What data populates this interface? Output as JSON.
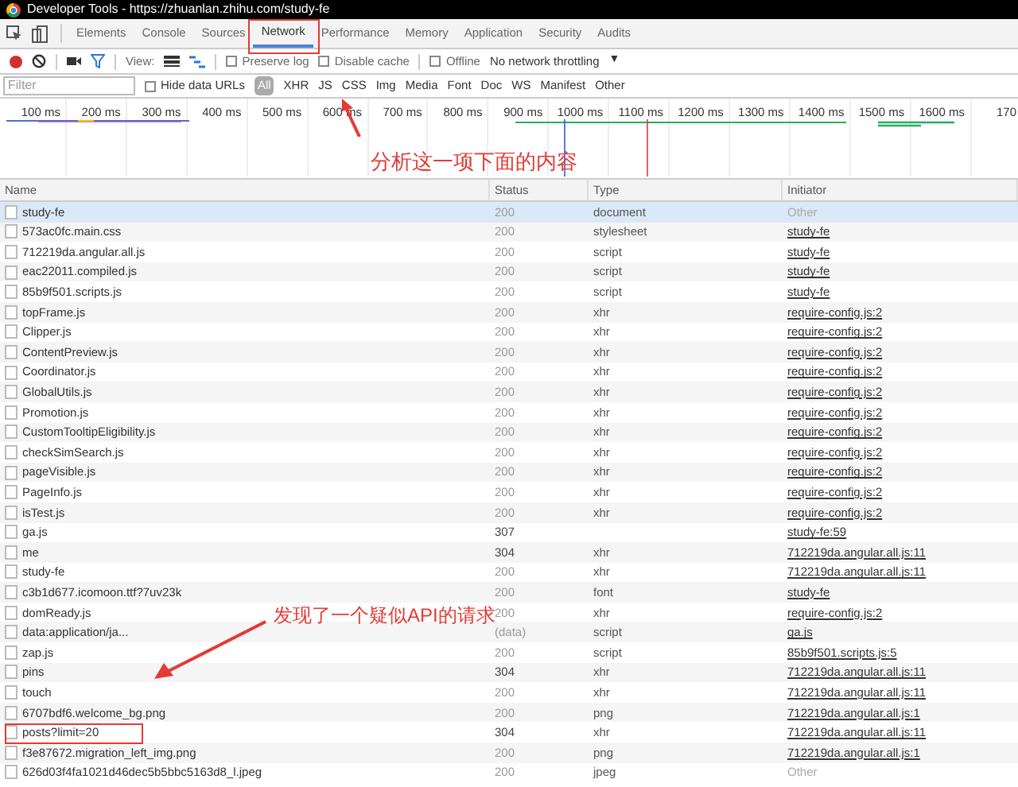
{
  "window": {
    "title": "Developer Tools - https://zhuanlan.zhihu.com/study-fe"
  },
  "tabs": [
    {
      "label": "Elements",
      "selected": false
    },
    {
      "label": "Console",
      "selected": false
    },
    {
      "label": "Sources",
      "selected": false
    },
    {
      "label": "Network",
      "selected": true
    },
    {
      "label": "Performance",
      "selected": false
    },
    {
      "label": "Memory",
      "selected": false
    },
    {
      "label": "Application",
      "selected": false
    },
    {
      "label": "Security",
      "selected": false
    },
    {
      "label": "Audits",
      "selected": false
    }
  ],
  "toolbar": {
    "view_label": "View:",
    "preserve_log": {
      "label": "Preserve log",
      "checked": false
    },
    "disable_cache": {
      "label": "Disable cache",
      "checked": false
    },
    "offline": {
      "label": "Offline",
      "checked": false
    },
    "throttling": "No network throttling",
    "throttling_caret": "▼"
  },
  "filter_bar": {
    "placeholder": "Filter",
    "hide_data_urls": {
      "label": "Hide data URLs",
      "checked": false
    },
    "types": [
      {
        "label": "All",
        "selected": true
      },
      {
        "label": "XHR",
        "selected": false
      },
      {
        "label": "JS",
        "selected": false
      },
      {
        "label": "CSS",
        "selected": false
      },
      {
        "label": "Img",
        "selected": false
      },
      {
        "label": "Media",
        "selected": false
      },
      {
        "label": "Font",
        "selected": false
      },
      {
        "label": "Doc",
        "selected": false
      },
      {
        "label": "WS",
        "selected": false
      },
      {
        "label": "Manifest",
        "selected": false
      },
      {
        "label": "Other",
        "selected": false
      }
    ]
  },
  "timeline": {
    "ticks": [
      "100 ms",
      "200 ms",
      "300 ms",
      "400 ms",
      "500 ms",
      "600 ms",
      "700 ms",
      "800 ms",
      "900 ms",
      "1000 ms",
      "1100 ms",
      "1200 ms",
      "1300 ms",
      "1400 ms",
      "1500 ms",
      "1600 ms",
      "170"
    ]
  },
  "table": {
    "columns": [
      "Name",
      "Status",
      "Type",
      "Initiator"
    ],
    "rows": [
      {
        "name": "study-fe",
        "status": "200",
        "type": "document",
        "initiator": "Other",
        "selected": true
      },
      {
        "name": "573ac0fc.main.css",
        "status": "200",
        "type": "stylesheet",
        "initiator": "study-fe",
        "selected": false
      },
      {
        "name": "712219da.angular.all.js",
        "status": "200",
        "type": "script",
        "initiator": "study-fe",
        "selected": false
      },
      {
        "name": "eac22011.compiled.js",
        "status": "200",
        "type": "script",
        "initiator": "study-fe",
        "selected": false
      },
      {
        "name": "85b9f501.scripts.js",
        "status": "200",
        "type": "script",
        "initiator": "study-fe",
        "selected": false
      },
      {
        "name": "topFrame.js",
        "status": "200",
        "type": "xhr",
        "initiator": "require-config.js:2",
        "selected": false
      },
      {
        "name": "Clipper.js",
        "status": "200",
        "type": "xhr",
        "initiator": "require-config.js:2",
        "selected": false
      },
      {
        "name": "ContentPreview.js",
        "status": "200",
        "type": "xhr",
        "initiator": "require-config.js:2",
        "selected": false
      },
      {
        "name": "Coordinator.js",
        "status": "200",
        "type": "xhr",
        "initiator": "require-config.js:2",
        "selected": false
      },
      {
        "name": "GlobalUtils.js",
        "status": "200",
        "type": "xhr",
        "initiator": "require-config.js:2",
        "selected": false
      },
      {
        "name": "Promotion.js",
        "status": "200",
        "type": "xhr",
        "initiator": "require-config.js:2",
        "selected": false
      },
      {
        "name": "CustomTooltipEligibility.js",
        "status": "200",
        "type": "xhr",
        "initiator": "require-config.js:2",
        "selected": false
      },
      {
        "name": "checkSimSearch.js",
        "status": "200",
        "type": "xhr",
        "initiator": "require-config.js:2",
        "selected": false
      },
      {
        "name": "pageVisible.js",
        "status": "200",
        "type": "xhr",
        "initiator": "require-config.js:2",
        "selected": false
      },
      {
        "name": "PageInfo.js",
        "status": "200",
        "type": "xhr",
        "initiator": "require-config.js:2",
        "selected": false
      },
      {
        "name": "isTest.js",
        "status": "200",
        "type": "xhr",
        "initiator": "require-config.js:2",
        "selected": false
      },
      {
        "name": "ga.js",
        "status": "307",
        "initiator": "study-fe:59",
        "selected": false
      },
      {
        "name": "me",
        "status": "304",
        "type": "xhr",
        "initiator": "712219da.angular.all.js:11",
        "selected": false
      },
      {
        "name": "study-fe",
        "status": "200",
        "type": "xhr",
        "initiator": "712219da.angular.all.js:11",
        "selected": false
      },
      {
        "name": "c3b1d677.icomoon.ttf?7uv23k",
        "status": "200",
        "type": "font",
        "initiator": "study-fe",
        "selected": false
      },
      {
        "name": "domReady.js",
        "status": "200",
        "type": "xhr",
        "initiator": "require-config.js:2",
        "selected": false
      },
      {
        "name": "data:application/ja...",
        "status": "(data)",
        "type": "script",
        "initiator": "ga.js",
        "selected": false
      },
      {
        "name": "zap.js",
        "status": "200",
        "type": "script",
        "initiator": "85b9f501.scripts.js:5",
        "selected": false
      },
      {
        "name": "pins",
        "status": "304",
        "type": "xhr",
        "initiator": "712219da.angular.all.js:11",
        "selected": false
      },
      {
        "name": "touch",
        "status": "200",
        "type": "xhr",
        "initiator": "712219da.angular.all.js:11",
        "selected": false
      },
      {
        "name": "6707bdf6.welcome_bg.png",
        "status": "200",
        "type": "png",
        "initiator": "712219da.angular.all.js:1",
        "selected": false
      },
      {
        "name": "posts?limit=20",
        "status": "304",
        "type": "xhr",
        "initiator": "712219da.angular.all.js:11",
        "selected": false
      },
      {
        "name": "f3e87672.migration_left_img.png",
        "status": "200",
        "type": "png",
        "initiator": "712219da.angular.all.js:1",
        "selected": false
      },
      {
        "name": "626d03f4fa1021d46dec5b5bbc5163d8_l.jpeg",
        "status": "200",
        "type": "jpeg",
        "initiator": "Other",
        "selected": false
      }
    ]
  },
  "annotations": [
    "分析这一项下面的内容",
    "发现了一个疑似API的请求"
  ]
}
